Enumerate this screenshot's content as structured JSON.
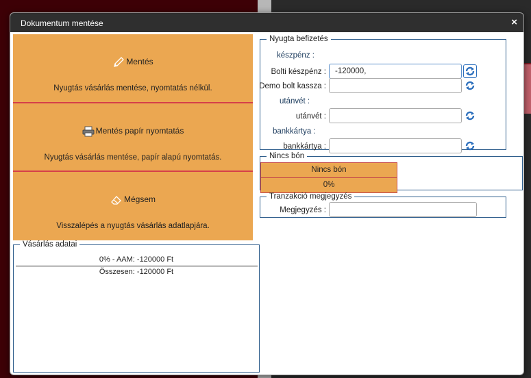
{
  "dialog": {
    "title": "Dokumentum mentése",
    "close": "×"
  },
  "actions": [
    {
      "label": "Mentés",
      "description": "Nyugtás vásárlás mentése, nyomtatás nélkül.",
      "icon": "pencil-icon"
    },
    {
      "label": "Mentés papír nyomtatás",
      "description": "Nyugtás vásárlás mentése, papír alapú nyomtatás.",
      "icon": "printer-icon"
    },
    {
      "label": "Mégsem",
      "description": "Visszalépés a nyugtás vásárlás adatlapjára.",
      "icon": "eraser-icon"
    }
  ],
  "payment": {
    "legend": "Nyugta befizetés",
    "cash_group": "készpénz :",
    "fields": [
      {
        "label": "Bolti készpénz :",
        "value": "-120000,",
        "placeholder": ""
      },
      {
        "label": "Demo bolt kassza :",
        "value": "",
        "placeholder": ""
      }
    ],
    "cod_group": "utánvét :",
    "cod_field": {
      "label": "utánvét :",
      "value": ""
    },
    "card_group": "bankkártya :",
    "card_field": {
      "label": "bankkártya :",
      "value": ""
    }
  },
  "no_receipt": {
    "legend": "Nincs bón",
    "header": "Nincs bón",
    "value": "0%"
  },
  "note": {
    "legend": "Tranzakció megjegyzés",
    "label": "Megjegyzés :",
    "value": ""
  },
  "purchase": {
    "legend": "Vásárlás adatai",
    "rows": [
      {
        "label": "0% - AAM:",
        "value": "-120000 Ft"
      },
      {
        "label": "Összesen:",
        "value": "-120000 Ft"
      }
    ]
  },
  "colors": {
    "action_bg": "#eba751",
    "separator": "#d6404a",
    "fieldset_border": "#2e5d8c",
    "title_bg": "#2f2f2f",
    "refresh_icon": "#2c6fbd"
  }
}
